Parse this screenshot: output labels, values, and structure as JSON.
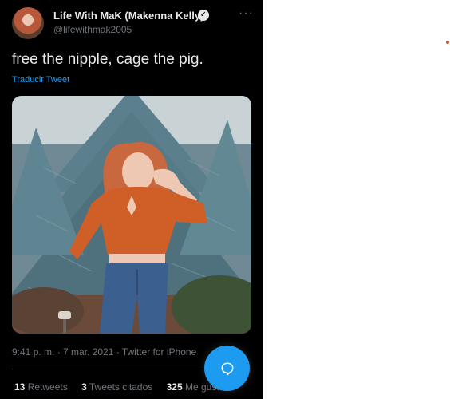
{
  "author": {
    "display_name": "Life With MaK (Makenna Kelly)",
    "handle": "@lifewithmak2005",
    "verified_icon": "check"
  },
  "tweet": {
    "text": "free the nipple, cage the pig.",
    "translate_label": "Traducir Tweet",
    "timestamp": "9:41 p. m. · 7 mar. 2021 · Twitter for iPhone"
  },
  "stats": {
    "retweets_count": "13",
    "retweets_label": "Retweets",
    "quotes_count": "3",
    "quotes_label": "Tweets citados",
    "likes_count": "325",
    "likes_label": "Me gusta"
  },
  "colors": {
    "background": "#000000",
    "accent": "#1d9bf0",
    "secondary_text": "#71767b"
  },
  "icons": {
    "more": "more-horizontal-icon",
    "compose": "reply-bubble-icon"
  }
}
